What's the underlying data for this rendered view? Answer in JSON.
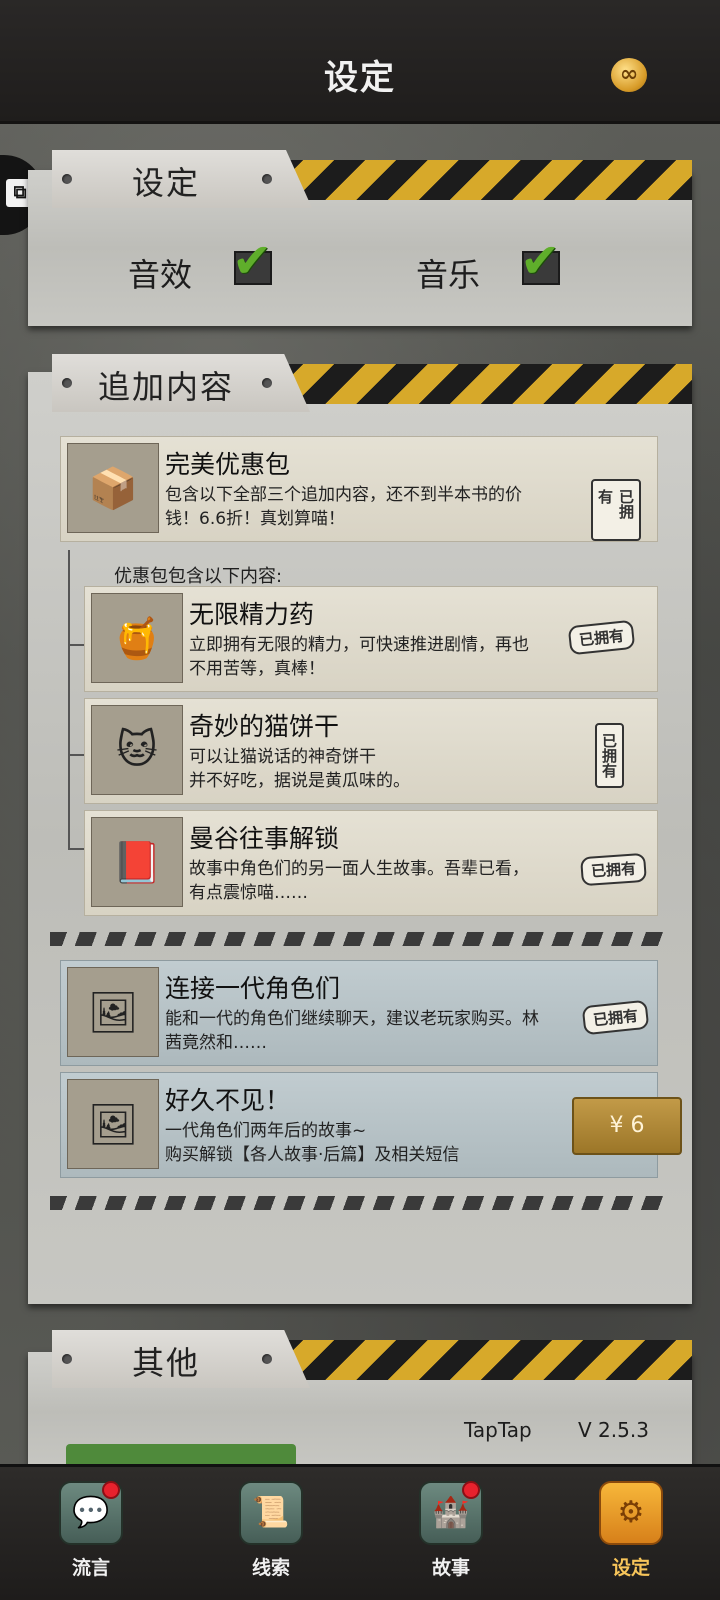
{
  "header": {
    "title": "设定",
    "badge_icon": "infinity-coin-icon"
  },
  "settings_panel": {
    "tab_label": "设定",
    "sound_effects_label": "音效",
    "music_label": "音乐",
    "sound_effects_checked": true,
    "music_checked": true
  },
  "addon_panel": {
    "tab_label": "追加内容",
    "bundle": {
      "title": "完美优惠包",
      "desc": "包含以下全部三个追加内容，还不到半本书的价钱！6.6折！真划算喵！",
      "status": "已拥有"
    },
    "bundle_contents_label": "优惠包包含以下内容:",
    "items": [
      {
        "title": "无限精力药",
        "desc": "立即拥有无限的精力，可快速推进剧情，再也不用苦等，真棒！",
        "status": "已拥有"
      },
      {
        "title": "奇妙的猫饼干",
        "desc": "可以让猫说话的神奇饼干\n并不好吃，据说是黄瓜味的。",
        "status": "已拥有"
      },
      {
        "title": "曼谷往事解锁",
        "desc": "故事中角色们的另一面人生故事。吾辈已看，有点震惊喵……",
        "status": "已拥有"
      }
    ],
    "extras": [
      {
        "title": "连接一代角色们",
        "desc": "能和一代的角色们继续聊天，建议老玩家购买。林茜竟然和……",
        "status": "已拥有"
      },
      {
        "title": "好久不见！",
        "desc": "一代角色们两年后的故事~\n购买解锁【各人故事·后篇】及相关短信",
        "price": "¥ 6"
      }
    ]
  },
  "other_panel": {
    "tab_label": "其他",
    "store": "TapTap",
    "version": "V 2.5.3"
  },
  "bottom_nav": [
    {
      "label": "流言",
      "icon": "chat-bubble-icon",
      "badge": true,
      "active": false
    },
    {
      "label": "线索",
      "icon": "scroll-icon",
      "badge": false,
      "active": false
    },
    {
      "label": "故事",
      "icon": "tower-icon",
      "badge": true,
      "active": false
    },
    {
      "label": "设定",
      "icon": "gear-icon",
      "badge": false,
      "active": true
    }
  ],
  "colors": {
    "accent": "#d7a92a",
    "active_nav": "#f7b73a",
    "badge_red": "#e8222d"
  }
}
